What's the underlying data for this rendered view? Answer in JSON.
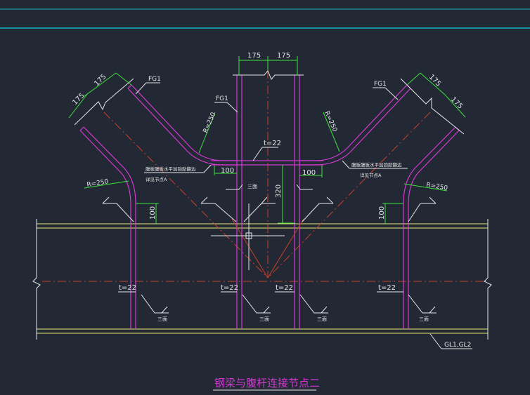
{
  "drawing": {
    "title": "钢梁与腹杆连接节点二",
    "colors": {
      "background": "#222834",
      "frame": "#19b2c4",
      "member": "#d23ad2",
      "flange": "#e8e870",
      "centerline": "#c8402c",
      "white": "#e6e6e6",
      "dim": "#3ee23e"
    },
    "dims": {
      "top_left_175": "175",
      "top_right_175": "175",
      "left_175_a": "175",
      "left_175_b": "175",
      "right_175_a": "175",
      "right_175_b": "175",
      "dim_100_left_top": "100",
      "dim_100_right_top": "100",
      "dim_100_left": "100",
      "dim_100_right": "100",
      "dim_320": "320"
    },
    "labels": {
      "fg1_left": "FG1",
      "fg1_center": "FG1",
      "fg1_right": "FG1",
      "radius_left_top": "R=250",
      "radius_right_top": "R=250",
      "radius_left": "R=250",
      "radius_right": "R=250",
      "thickness_top": "t=22",
      "t22_1": "t=22",
      "t22_2": "t=22",
      "t22_3": "t=22",
      "t22_4": "t=22",
      "note_left": "腹板腹板水平加劲肋翻边",
      "note_left_2": "详见节点A",
      "note_right": "腹板腹板水平加劲肋翻边",
      "note_right_2": "详见节点A",
      "weld_1": "三面",
      "weld_2": "三面",
      "weld_3": "三面",
      "weld_4": "三面",
      "weld_5": "三面",
      "beam_tag": "GL1,GL2"
    }
  }
}
